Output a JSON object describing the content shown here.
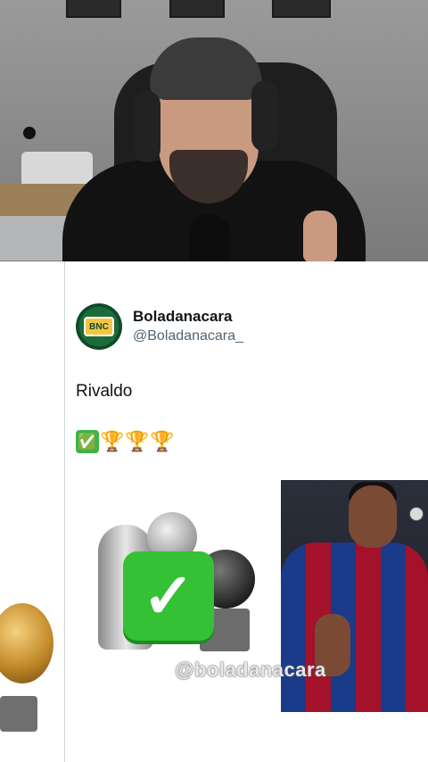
{
  "tweet": {
    "display_name": "Boladanacara",
    "handle": "@Boladanacara_",
    "avatar_text": "BNC",
    "text": "Rivaldo",
    "emojis": [
      "✅",
      "🏆",
      "🏆",
      "🏆"
    ]
  },
  "media": {
    "watermark": "@boladanacara"
  },
  "colors": {
    "name": "#0f1419",
    "handle": "#536471",
    "check_green": "#35c135"
  }
}
